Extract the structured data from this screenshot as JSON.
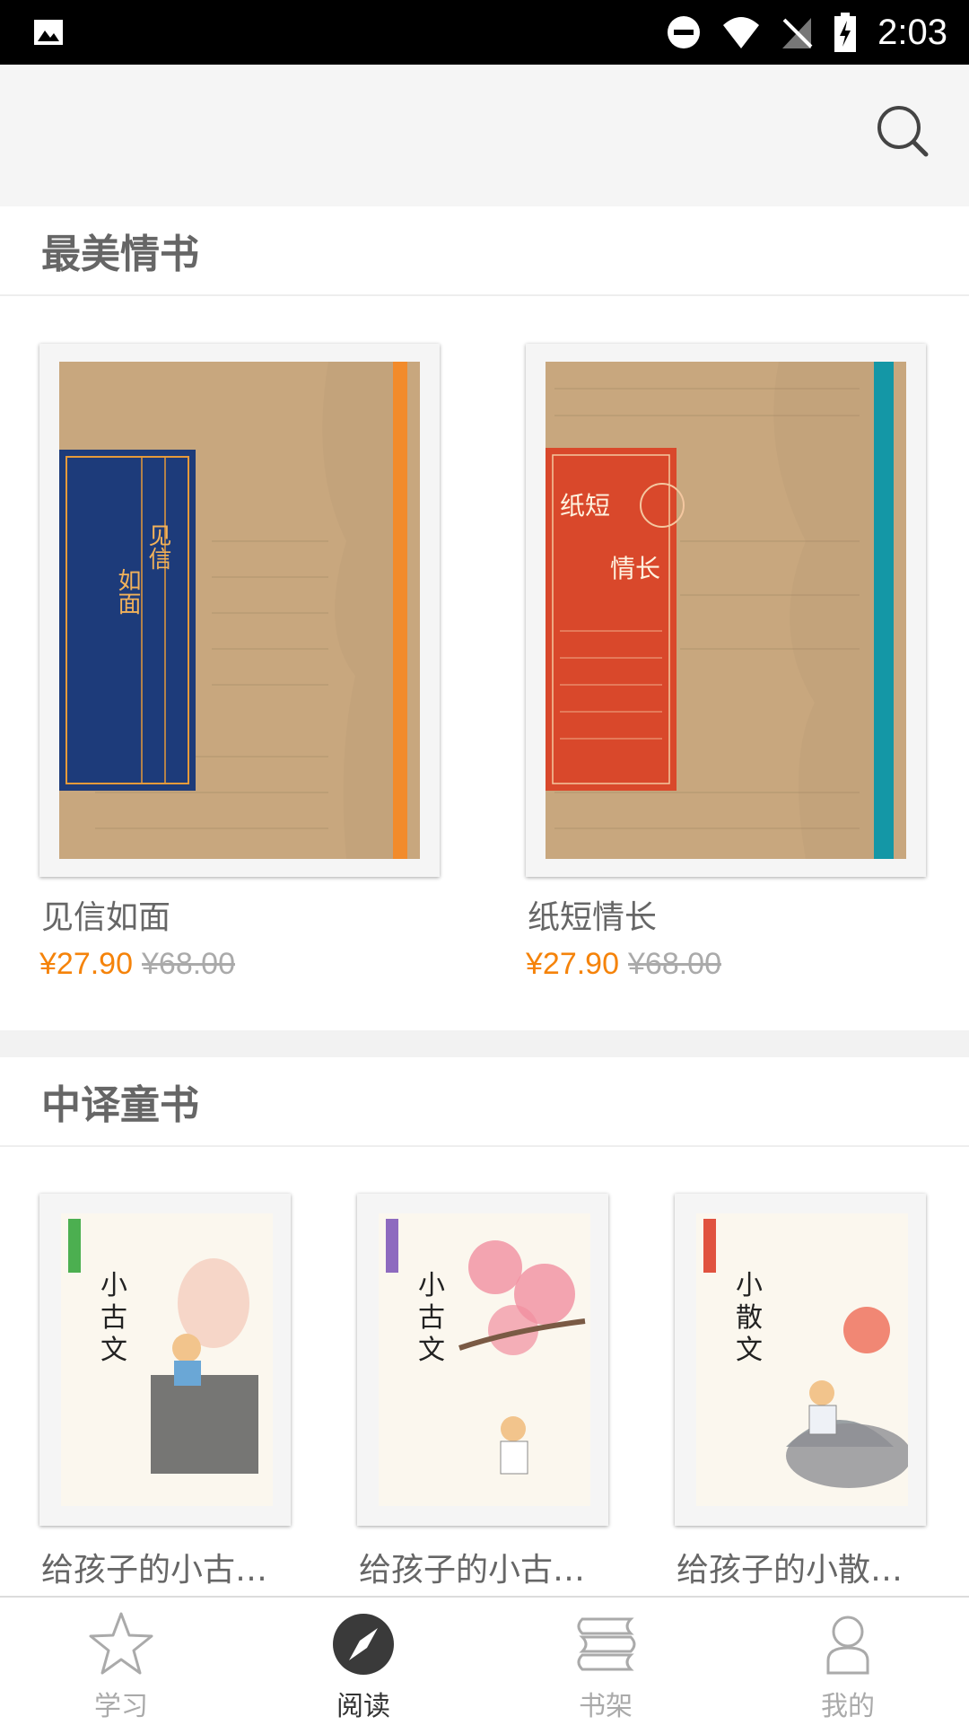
{
  "status_bar": {
    "time": "2:03"
  },
  "sections": [
    {
      "title": "最美情书",
      "books": [
        {
          "title": "见信如面",
          "price": "¥27.90",
          "original_price": "¥68.00",
          "cover_text": [
            "见信",
            "如面"
          ],
          "accent": "#1d3b7a"
        },
        {
          "title": "纸短情长",
          "price": "¥27.90",
          "original_price": "¥68.00",
          "cover_text": [
            "纸短",
            "情长"
          ],
          "accent": "#d9482b"
        }
      ]
    },
    {
      "title": "中译童书",
      "books": [
        {
          "title": "给孩子的小古文…",
          "cover_text": [
            "小",
            "古",
            "文"
          ],
          "accent": "#4caf50"
        },
        {
          "title": "给孩子的小古文…",
          "cover_text": [
            "小",
            "古",
            "文"
          ],
          "accent": "#8e6bbf"
        },
        {
          "title": "给孩子的小散文…",
          "cover_text": [
            "小",
            "散",
            "文"
          ],
          "accent": "#e0523f"
        }
      ]
    }
  ],
  "tabs": [
    {
      "label": "学习",
      "icon": "star-icon",
      "active": false
    },
    {
      "label": "阅读",
      "icon": "compass-icon",
      "active": true
    },
    {
      "label": "书架",
      "icon": "bookshelf-icon",
      "active": false
    },
    {
      "label": "我的",
      "icon": "person-icon",
      "active": false
    }
  ],
  "colors": {
    "price": "#f5830a",
    "old_price": "#aaaaaa",
    "title": "#666666",
    "active_tab": "#333333",
    "inactive_tab": "#aaaaaa"
  }
}
